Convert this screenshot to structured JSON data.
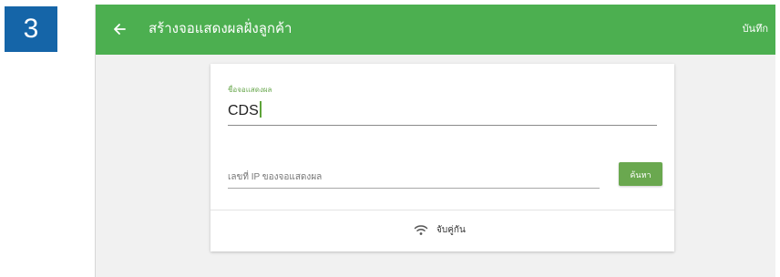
{
  "step": {
    "number": "3"
  },
  "appbar": {
    "title": "สร้างจอแสดงผลฝั่งลูกค้า",
    "save_label": "บันทึก",
    "back_icon": "arrow-left-icon",
    "color": "#4caf50"
  },
  "form": {
    "name_label": "ชื่อจอแสดงผล",
    "name_value": "CDS",
    "ip_placeholder": "เลขที่ IP ของจอแสดงผล",
    "ip_value": "",
    "search_label": "ค้นหา",
    "pair_label": "จับคู่กัน",
    "pair_icon": "wifi-icon",
    "accent_color": "#6aa84f"
  },
  "colors": {
    "step_badge": "#1565a8",
    "background": "#f1f1f1"
  }
}
